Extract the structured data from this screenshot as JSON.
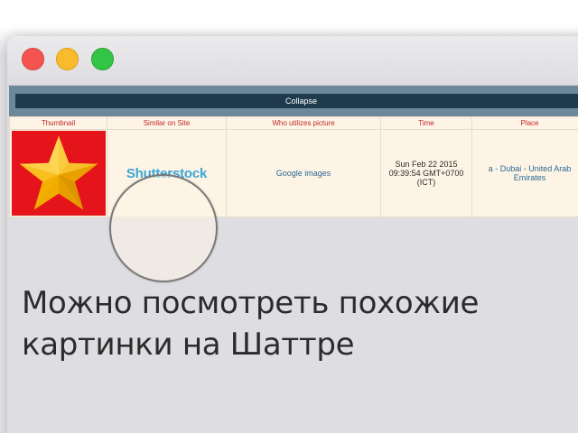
{
  "window": {
    "controls": [
      "close",
      "minimize",
      "zoom"
    ]
  },
  "report": {
    "collapse_label": "Collapse",
    "columns": [
      "Thumbnail",
      "Similar on Site",
      "Who utilizes picture",
      "Time",
      "Place"
    ],
    "row": {
      "thumbnail_icon": "star-icon",
      "similar_site": "Shutterstock",
      "who_utilizes": "Google images",
      "time": "Sun Feb 22 2015 09:39:54 GMT+0700 (ICT)",
      "place": "a - Dubai - United Arab Emirates"
    }
  },
  "caption": {
    "line1": "Можно посмотреть похожие",
    "line2": "картинки на Шаттре"
  },
  "colors": {
    "header_text": "#c1272d",
    "link": "#2a6896",
    "collapse_bar": "#1f3a4d",
    "thumb_bg": "#e5141b",
    "star": "#f6b500"
  }
}
